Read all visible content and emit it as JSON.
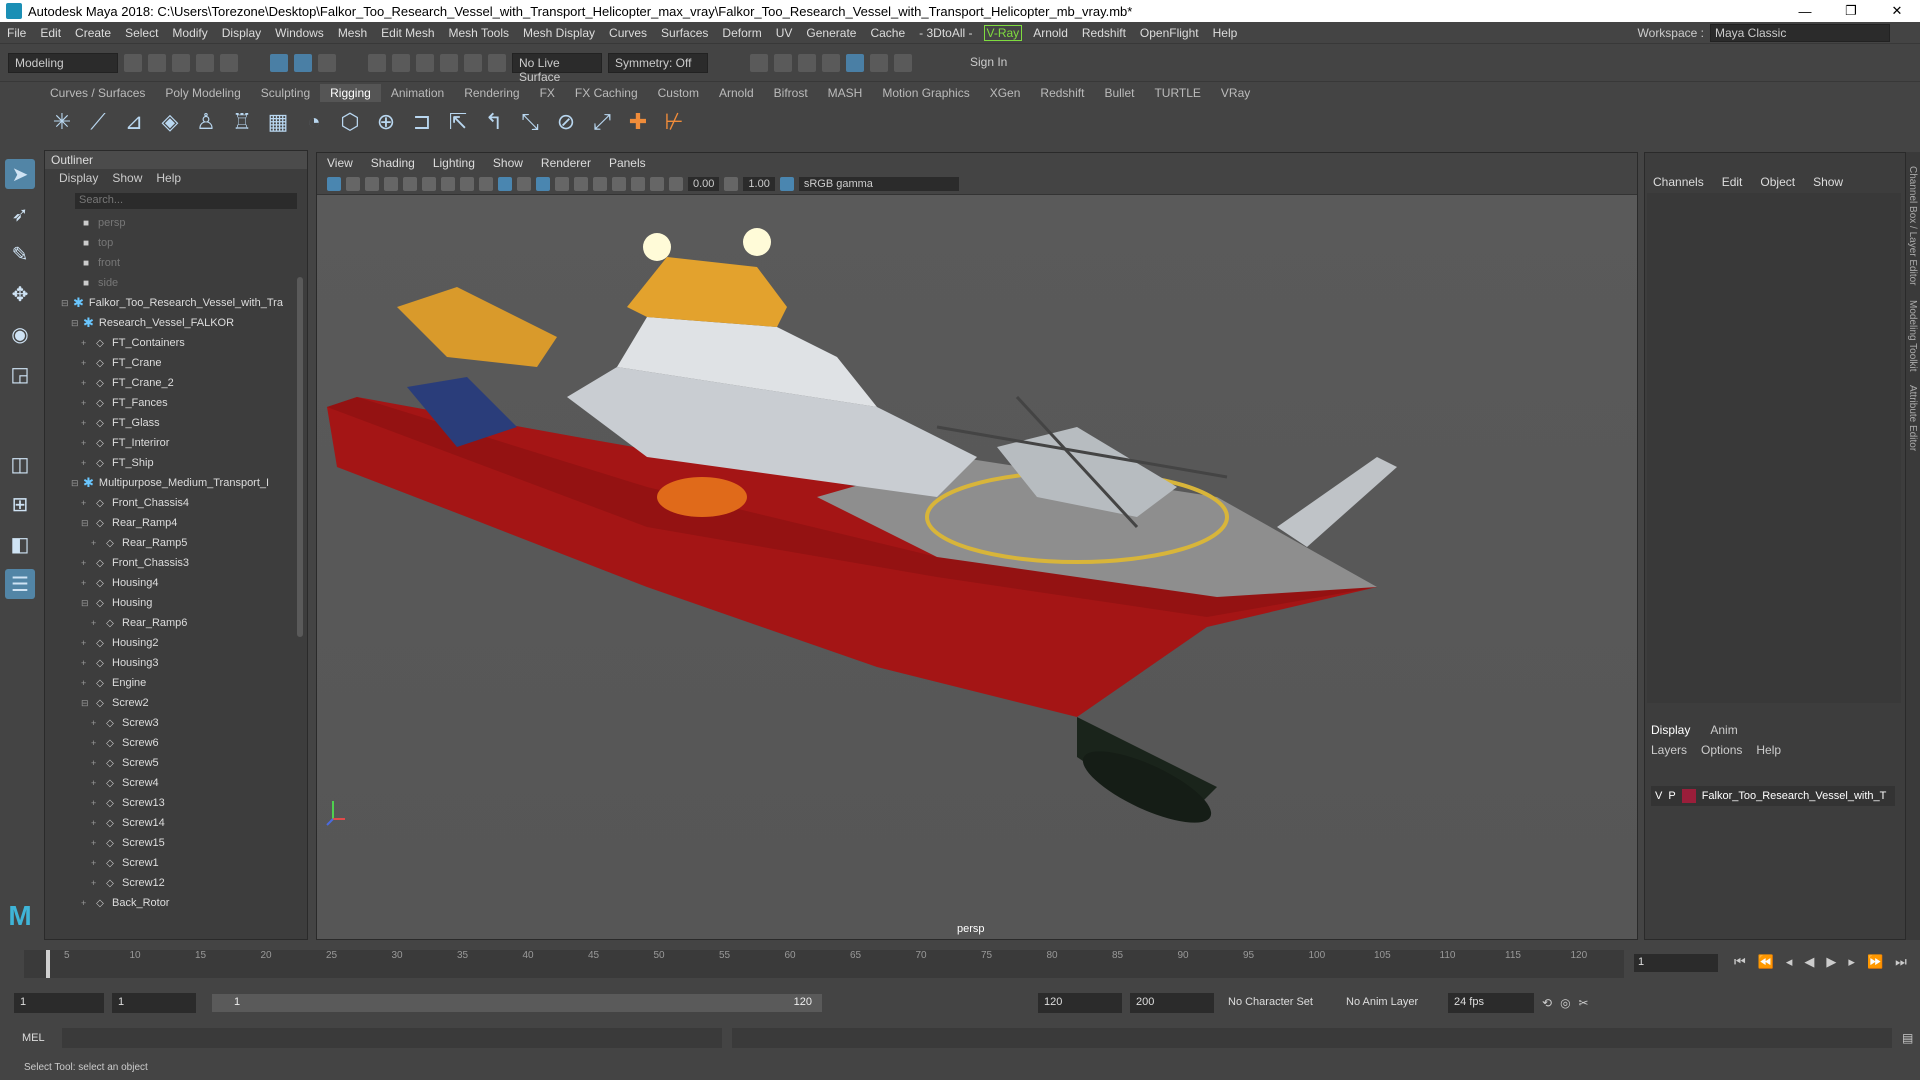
{
  "window": {
    "title": "Autodesk Maya 2018: C:\\Users\\Torezone\\Desktop\\Falkor_Too_Research_Vessel_with_Transport_Helicopter_max_vray\\Falkor_Too_Research_Vessel_with_Transport_Helicopter_mb_vray.mb*",
    "minimize": "—",
    "maximize": "❐",
    "close": "✕"
  },
  "menubar": {
    "items": [
      "File",
      "Edit",
      "Create",
      "Select",
      "Modify",
      "Display",
      "Windows",
      "Mesh",
      "Edit Mesh",
      "Mesh Tools",
      "Mesh Display",
      "Curves",
      "Surfaces",
      "Deform",
      "UV",
      "Generate",
      "Cache",
      "- 3DtoAll -"
    ],
    "vray": "V-Ray",
    "items2": [
      "Arnold",
      "Redshift",
      "OpenFlight",
      "Help"
    ],
    "workspace_label": "Workspace :",
    "workspace_value": "Maya Classic"
  },
  "statusline": {
    "mode": "Modeling",
    "live_surface": "No Live Surface",
    "symmetry": "Symmetry: Off",
    "sign_in": "Sign In"
  },
  "shelf": {
    "tabs": [
      "Curves / Surfaces",
      "Poly Modeling",
      "Sculpting",
      "Rigging",
      "Animation",
      "Rendering",
      "FX",
      "FX Caching",
      "Custom",
      "Arnold",
      "Bifrost",
      "MASH",
      "Motion Graphics",
      "XGen",
      "Redshift",
      "Bullet",
      "TURTLE",
      "VRay"
    ],
    "active": "Rigging"
  },
  "outliner": {
    "title": "Outliner",
    "menu": [
      "Display",
      "Show",
      "Help"
    ],
    "search_placeholder": "Search...",
    "cameras": [
      "persp",
      "top",
      "front",
      "side"
    ],
    "rows": [
      {
        "label": "Falkor_Too_Research_Vessel_with_Tra",
        "indent": 0,
        "type": "group",
        "exp": "⊟"
      },
      {
        "label": "Research_Vessel_FALKOR",
        "indent": 1,
        "type": "group",
        "exp": "⊟"
      },
      {
        "label": "FT_Containers",
        "indent": 2,
        "type": "mesh",
        "exp": "+"
      },
      {
        "label": "FT_Crane",
        "indent": 2,
        "type": "mesh",
        "exp": "+"
      },
      {
        "label": "FT_Crane_2",
        "indent": 2,
        "type": "mesh",
        "exp": "+"
      },
      {
        "label": "FT_Fances",
        "indent": 2,
        "type": "mesh",
        "exp": "+"
      },
      {
        "label": "FT_Glass",
        "indent": 2,
        "type": "mesh",
        "exp": "+"
      },
      {
        "label": "FT_Interiror",
        "indent": 2,
        "type": "mesh",
        "exp": "+"
      },
      {
        "label": "FT_Ship",
        "indent": 2,
        "type": "mesh",
        "exp": "+"
      },
      {
        "label": "Multipurpose_Medium_Transport_I",
        "indent": 1,
        "type": "group",
        "exp": "⊟"
      },
      {
        "label": "Front_Chassis4",
        "indent": 2,
        "type": "mesh",
        "exp": "+"
      },
      {
        "label": "Rear_Ramp4",
        "indent": 2,
        "type": "mesh",
        "exp": "⊟"
      },
      {
        "label": "Rear_Ramp5",
        "indent": 3,
        "type": "mesh",
        "exp": "+"
      },
      {
        "label": "Front_Chassis3",
        "indent": 2,
        "type": "mesh",
        "exp": "+"
      },
      {
        "label": "Housing4",
        "indent": 2,
        "type": "mesh",
        "exp": "+"
      },
      {
        "label": "Housing",
        "indent": 2,
        "type": "mesh",
        "exp": "⊟"
      },
      {
        "label": "Rear_Ramp6",
        "indent": 3,
        "type": "mesh",
        "exp": "+"
      },
      {
        "label": "Housing2",
        "indent": 2,
        "type": "mesh",
        "exp": "+"
      },
      {
        "label": "Housing3",
        "indent": 2,
        "type": "mesh",
        "exp": "+"
      },
      {
        "label": "Engine",
        "indent": 2,
        "type": "mesh",
        "exp": "+"
      },
      {
        "label": "Screw2",
        "indent": 2,
        "type": "mesh",
        "exp": "⊟"
      },
      {
        "label": "Screw3",
        "indent": 3,
        "type": "mesh",
        "exp": "+"
      },
      {
        "label": "Screw6",
        "indent": 3,
        "type": "mesh",
        "exp": "+"
      },
      {
        "label": "Screw5",
        "indent": 3,
        "type": "mesh",
        "exp": "+"
      },
      {
        "label": "Screw4",
        "indent": 3,
        "type": "mesh",
        "exp": "+"
      },
      {
        "label": "Screw13",
        "indent": 3,
        "type": "mesh",
        "exp": "+"
      },
      {
        "label": "Screw14",
        "indent": 3,
        "type": "mesh",
        "exp": "+"
      },
      {
        "label": "Screw15",
        "indent": 3,
        "type": "mesh",
        "exp": "+"
      },
      {
        "label": "Screw1",
        "indent": 3,
        "type": "mesh",
        "exp": "+"
      },
      {
        "label": "Screw12",
        "indent": 3,
        "type": "mesh",
        "exp": "+"
      },
      {
        "label": "Back_Rotor",
        "indent": 2,
        "type": "mesh",
        "exp": "+"
      }
    ]
  },
  "viewport": {
    "menu": [
      "View",
      "Shading",
      "Lighting",
      "Show",
      "Renderer",
      "Panels"
    ],
    "near_value": "0.00",
    "gamma_value": "1.00",
    "colorspace": "sRGB gamma",
    "camera_label": "persp"
  },
  "channelbox": {
    "menu": [
      "Channels",
      "Edit",
      "Object",
      "Show"
    ],
    "layer_tabs": [
      "Display",
      "Anim"
    ],
    "layer_menu": [
      "Layers",
      "Options",
      "Help"
    ],
    "layer_v": "V",
    "layer_p": "P",
    "layer_name": "Falkor_Too_Research_Vessel_with_T",
    "side_tabs": [
      "Channel Box / Layer Editor",
      "Modeling Toolkit",
      "Attribute Editor"
    ]
  },
  "timeline": {
    "ticks": [
      "5",
      "10",
      "15",
      "20",
      "25",
      "30",
      "35",
      "40",
      "45",
      "50",
      "55",
      "60",
      "65",
      "70",
      "75",
      "80",
      "85",
      "90",
      "95",
      "100",
      "105",
      "110",
      "115",
      "120"
    ],
    "current_frame": "1",
    "playhead_label": "1"
  },
  "range": {
    "start": "1",
    "anim_start": "1",
    "slider_start": "1",
    "slider_end": "120",
    "end": "120",
    "anim_end": "200",
    "character_set": "No Character Set",
    "anim_layer": "No Anim Layer",
    "fps": "24 fps"
  },
  "cmdline": {
    "label": "MEL"
  },
  "helpline": {
    "text": "Select Tool: select an object"
  }
}
